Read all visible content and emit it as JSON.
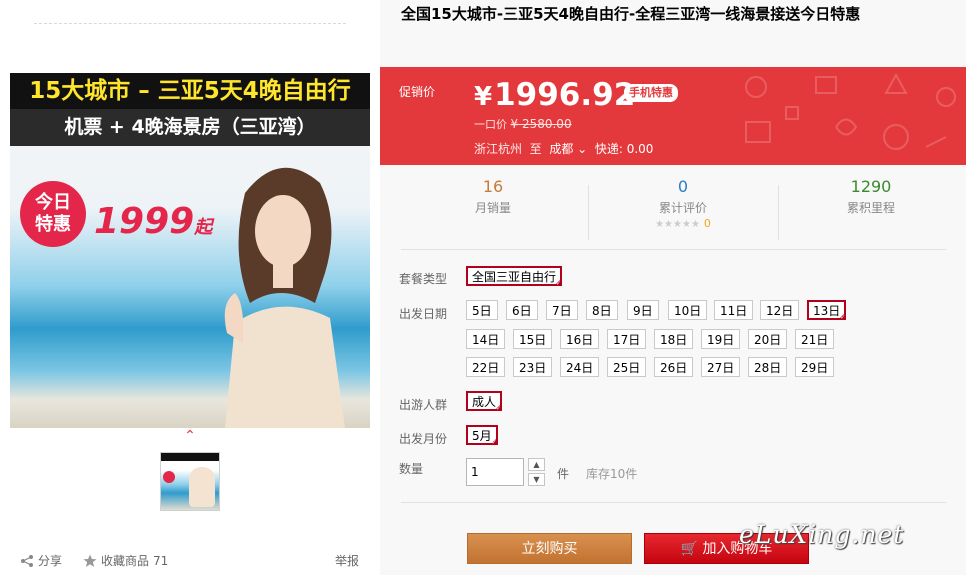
{
  "gallery": {
    "banner_line1": "15大城市 – 三亚5天4晚自由行",
    "banner_line2": "机票 + 4晚海景房（三亚湾）",
    "promo_badge": "今日特惠",
    "promo_price": "1999",
    "promo_price_suffix": "起",
    "footer": {
      "share_label": "分享",
      "favorite_label": "收藏商品",
      "favorite_count": "71",
      "report_label": "举报"
    }
  },
  "product": {
    "title": "全国15大城市-三亚5天4晚自由行-全程三亚湾一线海景接送今日特惠",
    "promo_label": "促销价",
    "currency": "¥",
    "price": "1996.92",
    "mobile_badge": "手机特惠",
    "original_label": "一口价",
    "original_price": "¥ 2580.00",
    "ship_from": "浙江杭州",
    "ship_to_word": "至",
    "ship_dest": "成都",
    "ship_fee": "快递: 0.00"
  },
  "stats": [
    {
      "value": "16",
      "label": "月销量",
      "color": "#c67c3a"
    },
    {
      "value": "0",
      "label": "累计评价",
      "color": "#2a7dc5",
      "stars": "★★★★★",
      "star_count": "0"
    },
    {
      "value": "1290",
      "label": "累积里程",
      "color": "#3a8a2e"
    }
  ],
  "options": {
    "package_label": "套餐类型",
    "package_value": "全国三亚自由行",
    "date_label": "出发日期",
    "dates": [
      "5日",
      "6日",
      "7日",
      "8日",
      "9日",
      "10日",
      "11日",
      "12日",
      "13日",
      "14日",
      "15日",
      "16日",
      "17日",
      "18日",
      "19日",
      "20日",
      "21日",
      "22日",
      "23日",
      "24日",
      "25日",
      "26日",
      "27日",
      "28日",
      "29日"
    ],
    "selected_date": "13日",
    "group_label": "出游人群",
    "group_value": "成人",
    "month_label": "出发月份",
    "month_value": "5月",
    "qty_label": "数量",
    "qty_value": "1",
    "unit": "件",
    "stock": "库存10件"
  },
  "actions": {
    "buy_now": "立刻购买",
    "add_cart": "加入购物车"
  },
  "watermark": "eLuXing.net"
}
